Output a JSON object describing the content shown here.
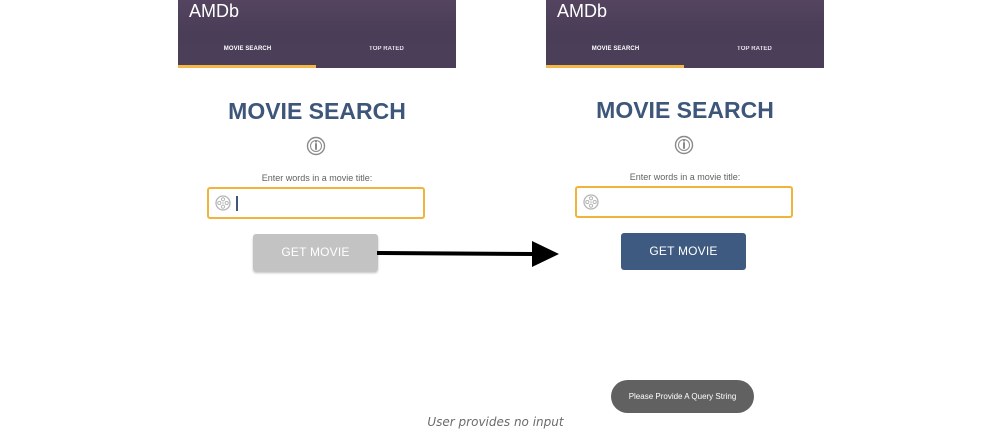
{
  "screens": [
    {
      "app_title": "AMDb",
      "tabs": [
        {
          "label": "MOVIE SEARCH",
          "active": true
        },
        {
          "label": "TOP RATED",
          "active": false
        }
      ],
      "heading": "MOVIE SEARCH",
      "prompt": "Enter words in a movie title:",
      "search_value": "",
      "button_label": "GET MOVIE",
      "button_state": "disabled"
    },
    {
      "app_title": "AMDb",
      "tabs": [
        {
          "label": "MOVIE SEARCH",
          "active": true
        },
        {
          "label": "TOP RATED",
          "active": false
        }
      ],
      "heading": "MOVIE SEARCH",
      "prompt": "Enter words in a movie title:",
      "search_value": "",
      "button_label": "GET MOVIE",
      "button_state": "enabled"
    }
  ],
  "toast": "Please Provide A Query String",
  "caption": "User provides no input",
  "icons": [
    "info-icon",
    "film-reel-icon",
    "right-arrow-icon"
  ],
  "colors": {
    "appbar": "#4a3d58",
    "tab_indicator": "#f3b74a",
    "heading": "#3d5679",
    "input_border": "#f0b43c",
    "button_disabled": "#c3c3c3",
    "button_enabled": "#3e5a80",
    "toast": "#616161"
  }
}
